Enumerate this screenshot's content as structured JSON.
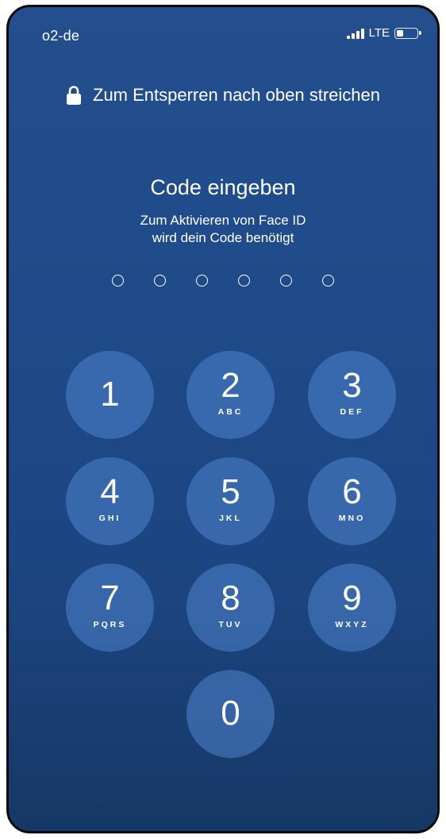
{
  "status_bar": {
    "carrier": "o2-de",
    "network": "LTE",
    "battery_level": 0.35
  },
  "lock_hint": {
    "icon": "lock-icon",
    "text": "Zum Entsperren nach oben streichen"
  },
  "passcode": {
    "title": "Code eingeben",
    "subtitle_line1": "Zum Aktivieren von Face ID",
    "subtitle_line2": "wird dein Code benötigt",
    "digits_total": 6,
    "digits_entered": 0
  },
  "keypad": {
    "keys": [
      {
        "digit": "1",
        "letters": ""
      },
      {
        "digit": "2",
        "letters": "ABC"
      },
      {
        "digit": "3",
        "letters": "DEF"
      },
      {
        "digit": "4",
        "letters": "GHI"
      },
      {
        "digit": "5",
        "letters": "JKL"
      },
      {
        "digit": "6",
        "letters": "MNO"
      },
      {
        "digit": "7",
        "letters": "PQRS"
      },
      {
        "digit": "8",
        "letters": "TUV"
      },
      {
        "digit": "9",
        "letters": "WXYZ"
      },
      {
        "digit": "0",
        "letters": ""
      }
    ]
  },
  "colors": {
    "background_top": "#234f8e",
    "background_bottom": "#163866",
    "key_fill": "#4e84ce",
    "text": "#ffffff"
  }
}
